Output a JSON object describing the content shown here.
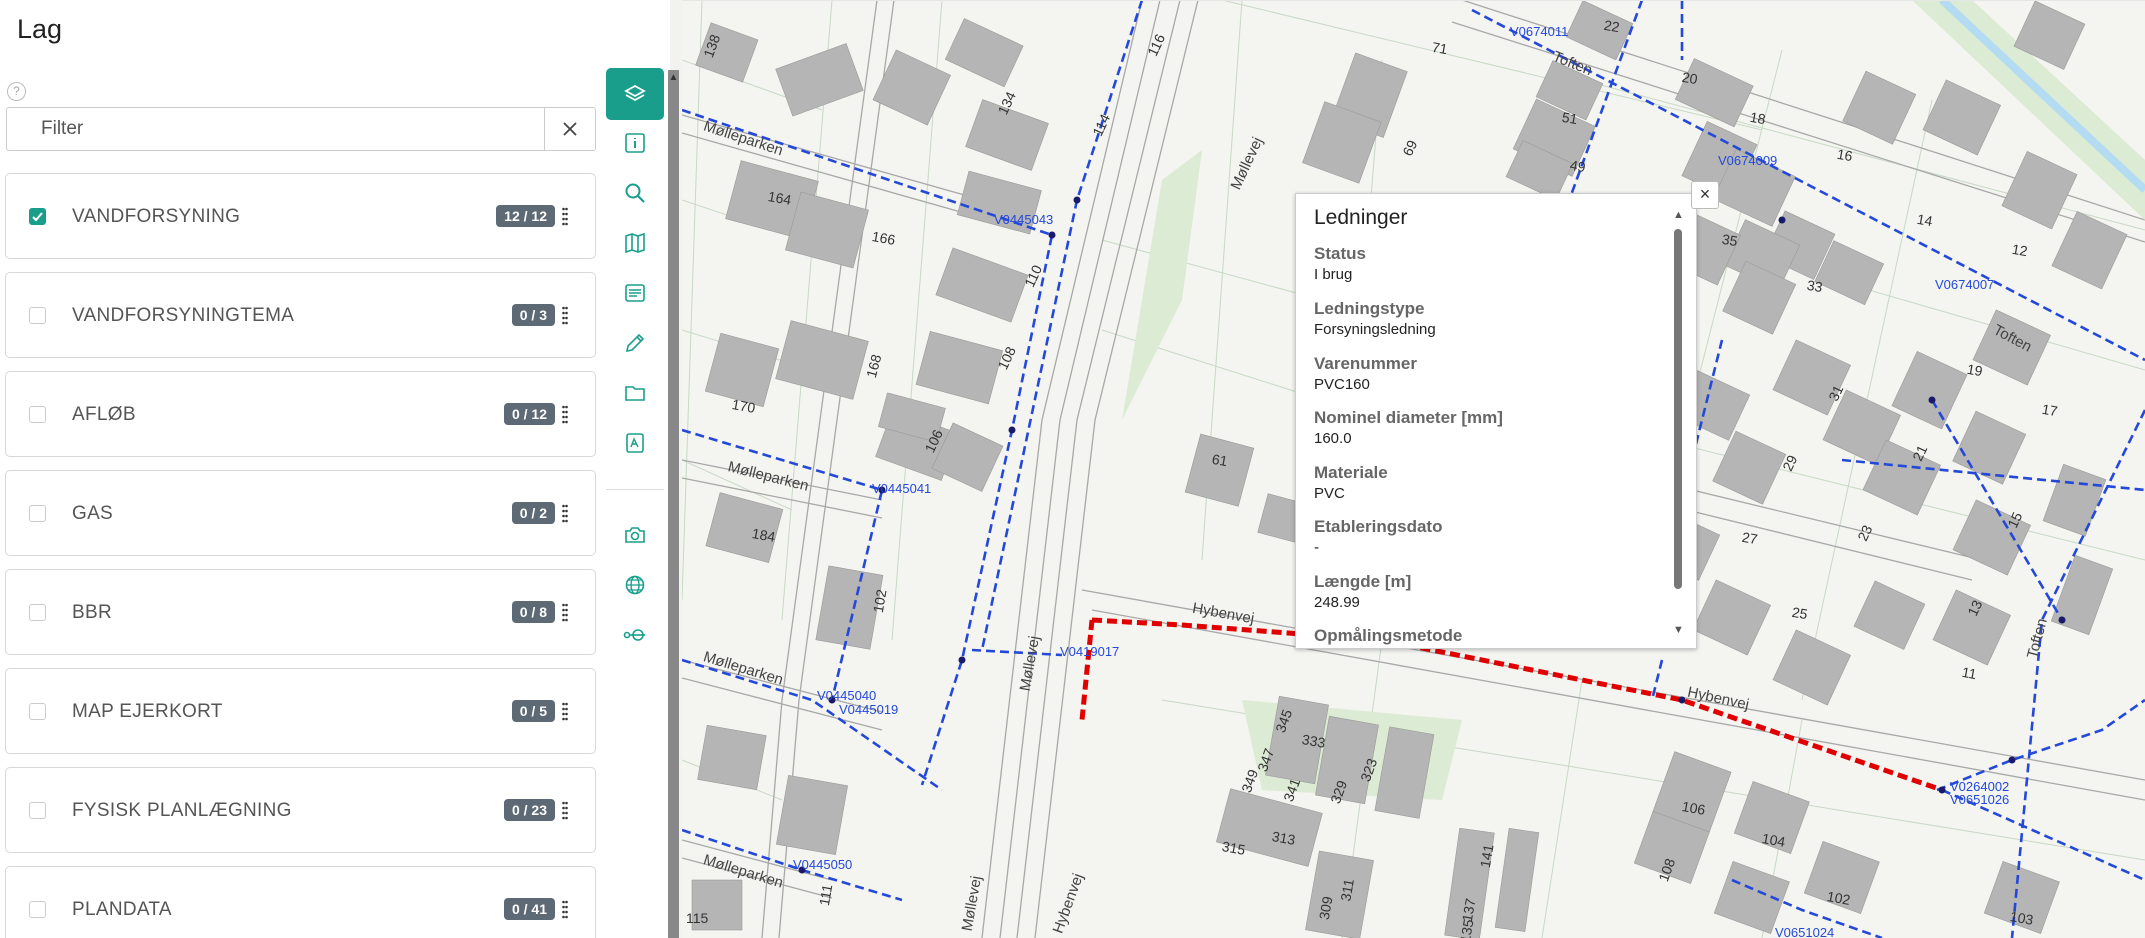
{
  "panel": {
    "title": "Lag",
    "help": "?",
    "filter_placeholder": "Filter",
    "layers": [
      {
        "label": "VANDFORSYNING",
        "badge": "12 / 12",
        "checked": true
      },
      {
        "label": "VANDFORSYNINGTEMA",
        "badge": "0 / 3",
        "checked": false
      },
      {
        "label": "AFLØB",
        "badge": "0 / 12",
        "checked": false
      },
      {
        "label": "GAS",
        "badge": "0 / 2",
        "checked": false
      },
      {
        "label": "BBR",
        "badge": "0 / 8",
        "checked": false
      },
      {
        "label": "MAP EJERKORT",
        "badge": "0 / 5",
        "checked": false
      },
      {
        "label": "FYSISK PLANLÆGNING",
        "badge": "0 / 23",
        "checked": false
      },
      {
        "label": "PLANDATA",
        "badge": "0 / 41",
        "checked": false
      }
    ]
  },
  "toolbar": {
    "icons": [
      "layers-icon",
      "info-icon",
      "search-icon",
      "map-icon",
      "legend-icon",
      "pencil-icon",
      "folder-icon",
      "pdf-icon",
      "camera-icon",
      "globe-icon",
      "measure-icon"
    ]
  },
  "colors": {
    "accent": "#1a9e8c",
    "badge": "#5d6974",
    "pipe": "#2449d8",
    "selected_pipe": "#e00000",
    "building": "#b3b3b3"
  },
  "map": {
    "streets": [
      "Mølleparken",
      "Mølleparken",
      "Mølleparken",
      "Mølleparken",
      "Møllevej",
      "Møllevej",
      "Møllevej",
      "Hybenvej",
      "Hybenvej",
      "Hybenvej",
      "Toften",
      "Toften",
      "Toften"
    ],
    "pipe_ids": [
      "V0674011",
      "V0674009",
      "V0674007",
      "V0445043",
      "V0445041",
      "V0419017",
      "V0445040",
      "V0445019",
      "V0445050",
      "V0264002",
      "V0651026",
      "V0651024"
    ],
    "house_numbers": [
      "138",
      "134",
      "116",
      "114",
      "110",
      "108",
      "106",
      "102",
      "111",
      "115",
      "164",
      "166",
      "168",
      "170",
      "184",
      "71",
      "69",
      "51",
      "49",
      "22",
      "20",
      "18",
      "16",
      "14",
      "12",
      "35",
      "33",
      "31",
      "29",
      "27",
      "25",
      "23",
      "21",
      "19",
      "17",
      "15",
      "13",
      "11",
      "61",
      "345",
      "347",
      "349",
      "341",
      "333",
      "329",
      "323",
      "313",
      "315",
      "311",
      "309",
      "141",
      "137",
      "135",
      "106",
      "104",
      "108",
      "102",
      "103"
    ]
  },
  "popup": {
    "title": "Ledninger",
    "close": "×",
    "rows": [
      {
        "label": "Status",
        "value": "I brug"
      },
      {
        "label": "Ledningstype",
        "value": "Forsyningsledning"
      },
      {
        "label": "Varenummer",
        "value": "PVC160"
      },
      {
        "label": "Nominel diameter [mm]",
        "value": "160.0"
      },
      {
        "label": "Materiale",
        "value": "PVC"
      },
      {
        "label": "Etableringsdato",
        "value": "-"
      },
      {
        "label": "Længde [m]",
        "value": "248.99"
      },
      {
        "label": "Opmålingsmetode",
        "value": ""
      }
    ]
  }
}
